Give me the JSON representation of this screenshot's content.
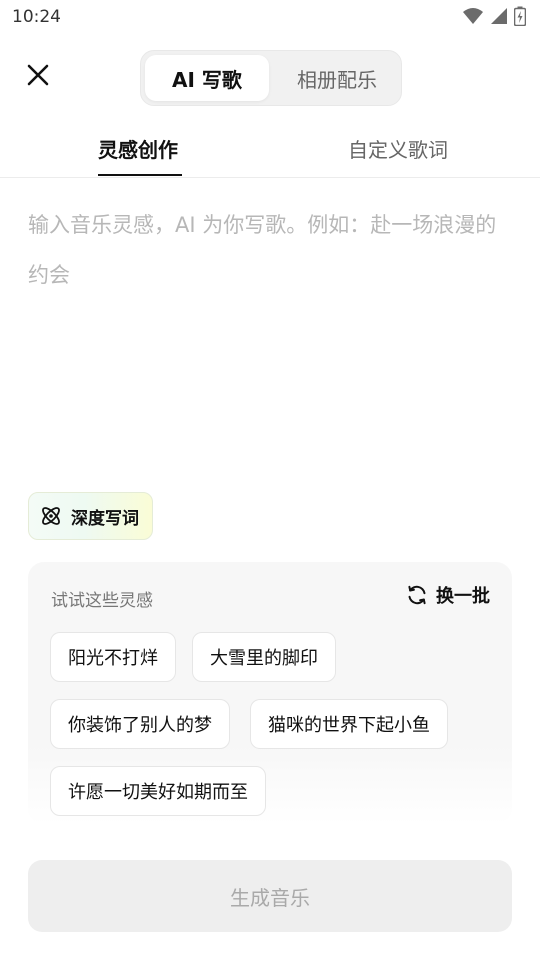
{
  "status_bar": {
    "time": "10:24",
    "icons": [
      "wifi-icon",
      "signal-icon",
      "battery-icon"
    ]
  },
  "top_bar": {
    "close_icon": "close-icon",
    "modes": [
      {
        "label": "AI 写歌",
        "active": true
      },
      {
        "label": "相册配乐",
        "active": false
      }
    ]
  },
  "tabs": [
    {
      "label": "灵感创作",
      "active": true
    },
    {
      "label": "自定义歌词",
      "active": false
    }
  ],
  "input": {
    "value": "",
    "placeholder": "输入音乐灵感，AI 为你写歌。例如：赴一场浪漫的约会"
  },
  "deep_write": {
    "label": "深度写词",
    "icon": "atom-icon"
  },
  "suggestions": {
    "title": "试试这些灵感",
    "refresh_label": "换一批",
    "refresh_icon": "refresh-icon",
    "chips": [
      "阳光不打烊",
      "大雪里的脚印",
      "你装饰了别人的梦",
      "猫咪的世界下起小鱼",
      "许愿一切美好如期而至"
    ]
  },
  "generate": {
    "label": "生成音乐",
    "enabled": false
  },
  "colors": {
    "text_primary": "#111111",
    "text_secondary": "#666666",
    "placeholder": "#b7b7b7",
    "button_disabled_bg": "#eeeeee",
    "button_disabled_text": "#a9a9a9"
  }
}
